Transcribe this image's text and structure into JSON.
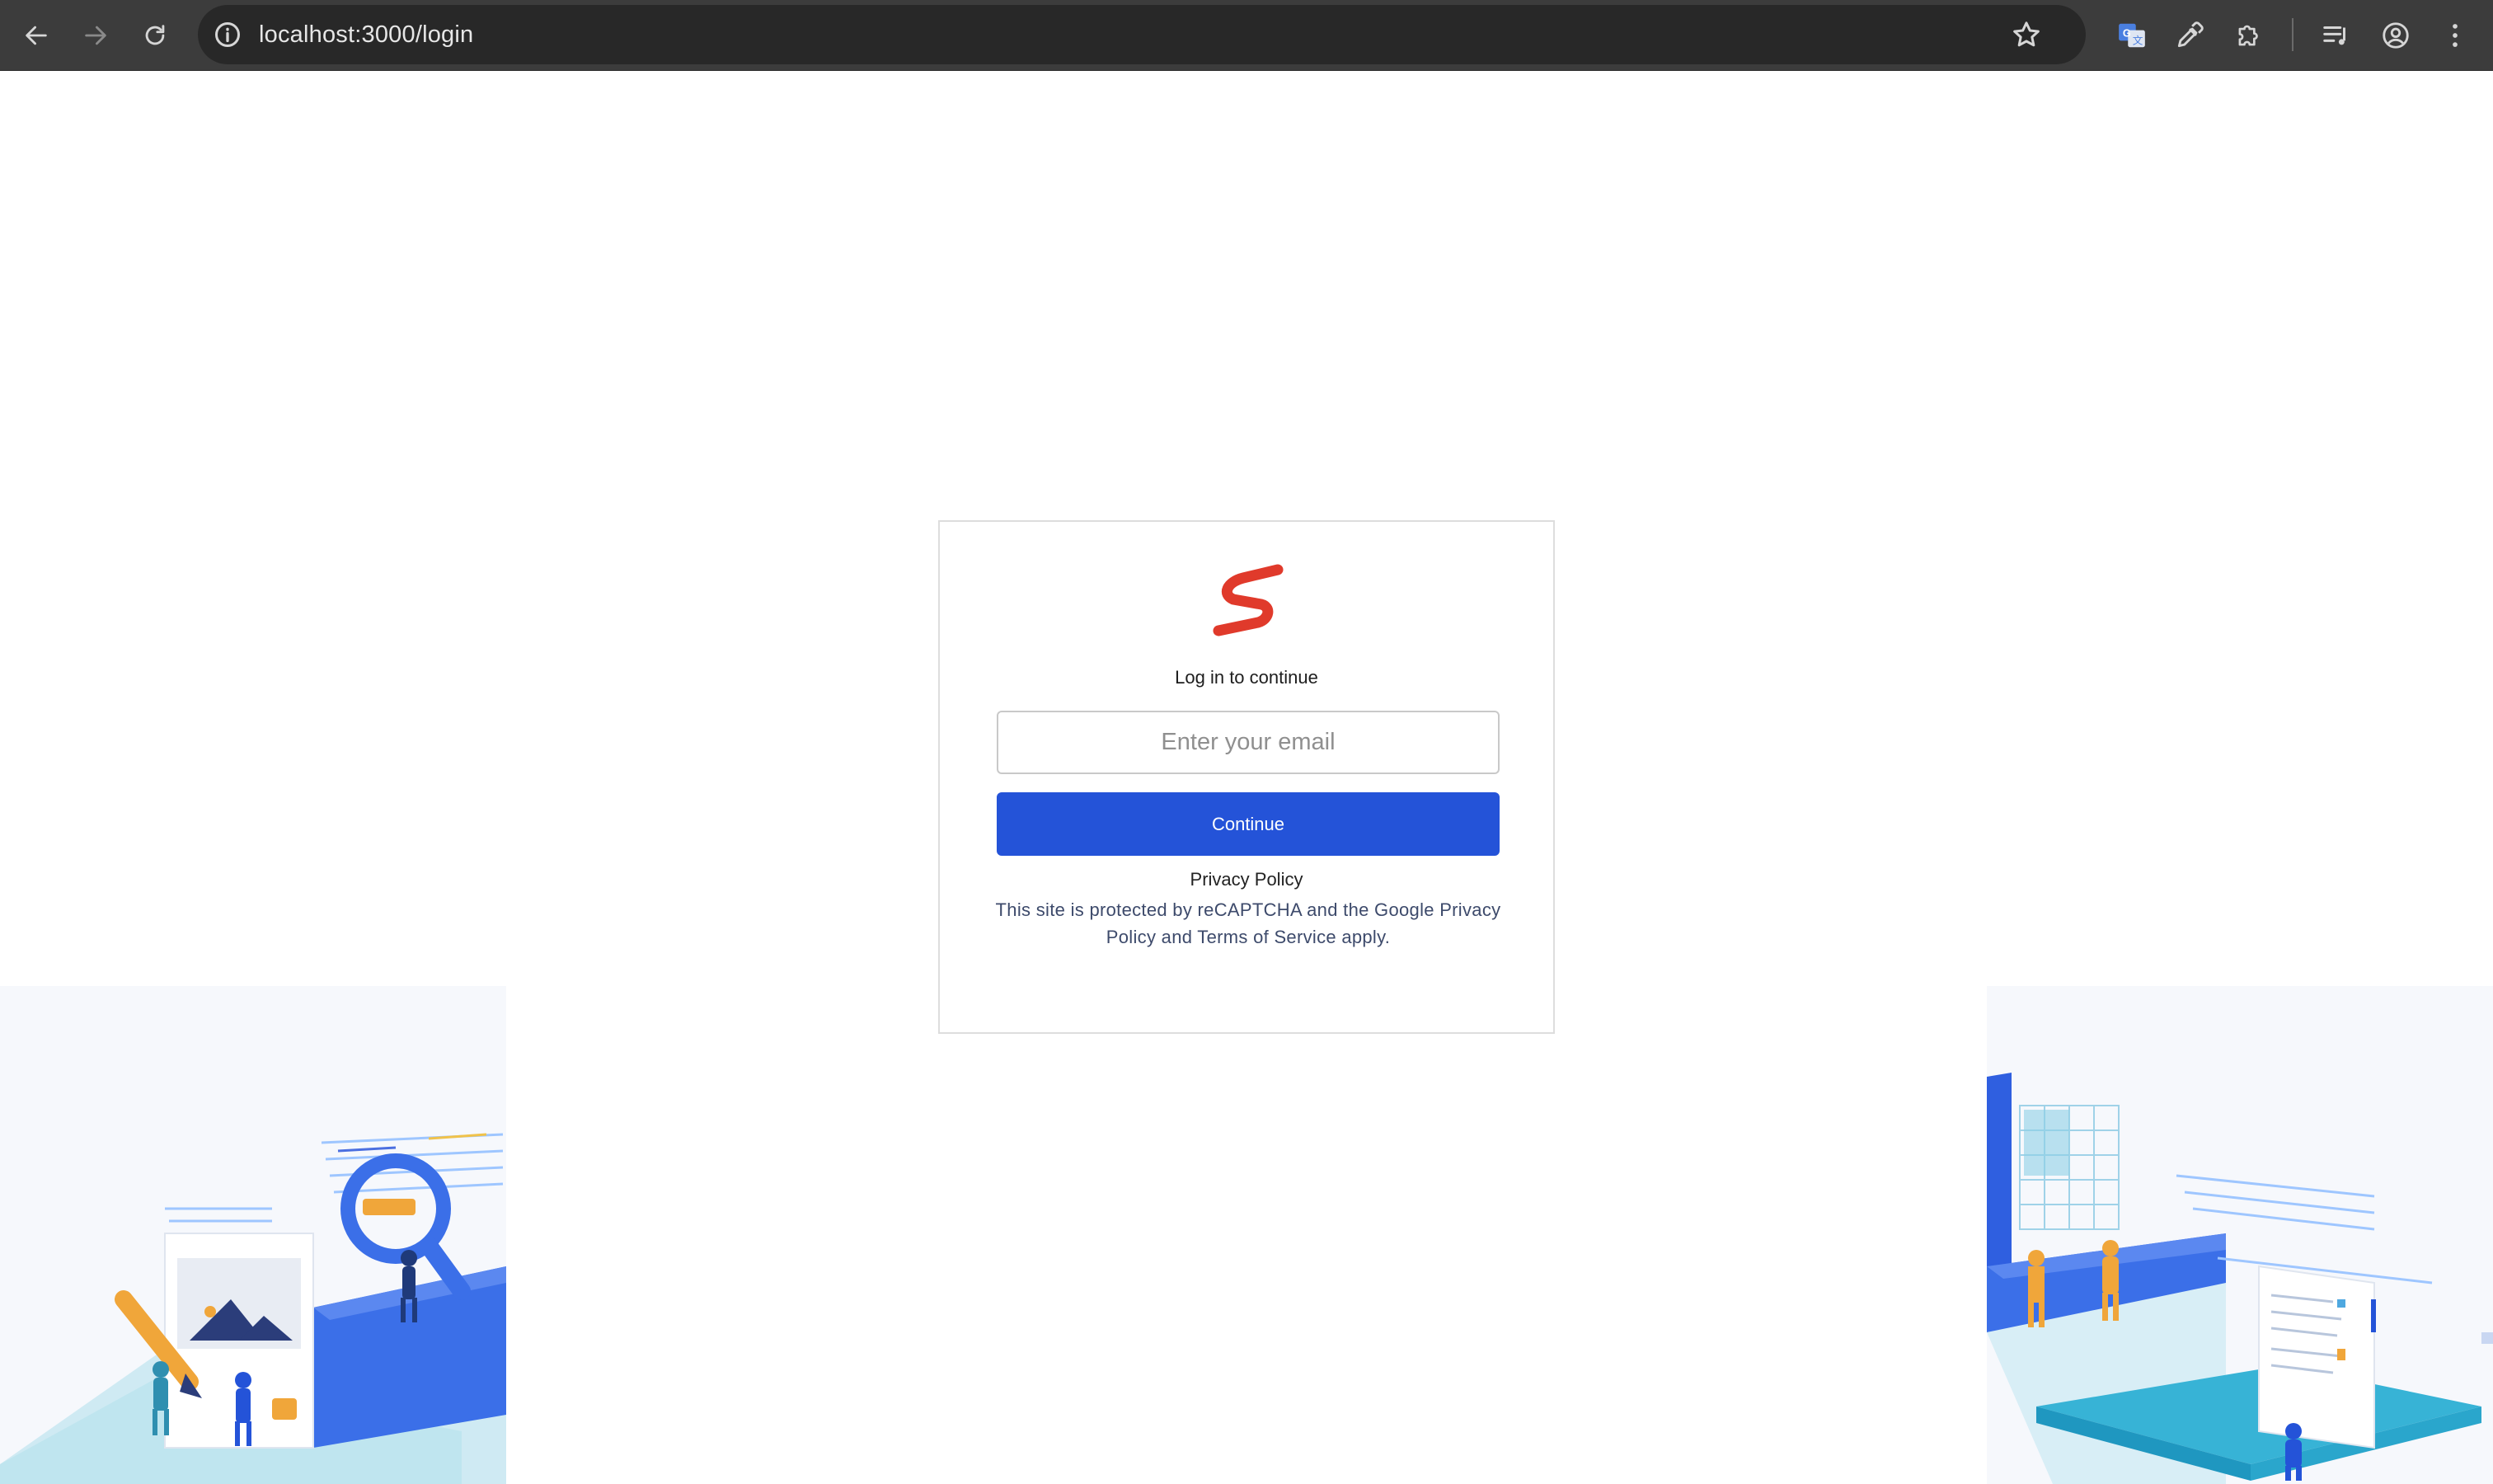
{
  "browser": {
    "url": "localhost:3000/login",
    "icons": {
      "back": "back-arrow-icon",
      "forward": "forward-arrow-icon",
      "reload": "reload-icon",
      "info": "site-info-icon",
      "bookmark": "bookmark-star-icon",
      "translate": "google-translate-icon",
      "eyedropper": "eyedropper-icon",
      "extensions": "puzzle-icon",
      "media": "media-control-icon",
      "profile": "profile-icon",
      "menu": "kebab-menu-icon"
    }
  },
  "login": {
    "heading": "Log in to continue",
    "email_placeholder": "Enter your email",
    "continue_label": "Continue",
    "privacy_label": "Privacy Policy",
    "recaptcha_notice": "This site is protected by reCAPTCHA and the Google Privacy Policy and Terms of Service apply."
  },
  "colors": {
    "brand_red": "#e03a2b",
    "primary_blue": "#2453d8",
    "toolbar_bg": "#3c3c3c"
  }
}
